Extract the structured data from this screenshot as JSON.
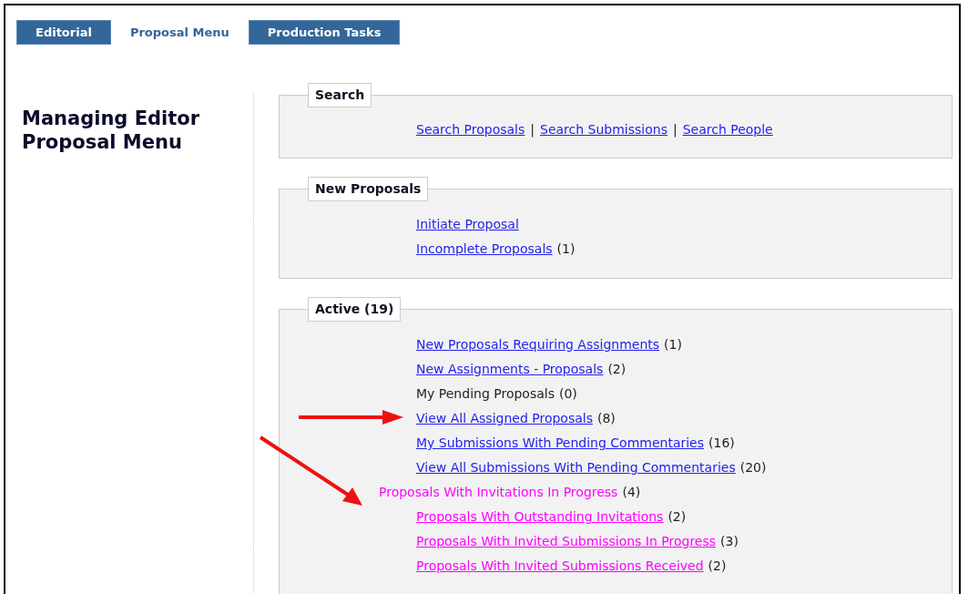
{
  "tabs": [
    {
      "label": "Editorial",
      "selected": false
    },
    {
      "label": "Proposal Menu",
      "selected": true
    },
    {
      "label": "Production Tasks",
      "selected": false
    }
  ],
  "page_title": "Managing Editor Proposal Menu",
  "sections": [
    {
      "title": "Search",
      "kind": "inline",
      "items": [
        {
          "kind": "link",
          "label": "Search Proposals",
          "color": "#2222ee"
        },
        {
          "kind": "separator",
          "label": "|",
          "color": "#222222"
        },
        {
          "kind": "link",
          "label": "Search Submissions",
          "color": "#2222ee"
        },
        {
          "kind": "separator",
          "label": "|",
          "color": "#222222"
        },
        {
          "kind": "link",
          "label": "Search People",
          "color": "#2222ee"
        }
      ]
    },
    {
      "title": "New Proposals",
      "kind": "list",
      "items": [
        {
          "kind": "link",
          "label": "Initiate Proposal",
          "color": "#2222ee"
        },
        {
          "kind": "link",
          "label": "Incomplete Proposals",
          "count": "(1)",
          "color": "#2222ee"
        }
      ]
    },
    {
      "title": "Active (19)",
      "kind": "list",
      "items": [
        {
          "kind": "link",
          "label": "New Proposals Requiring Assignments",
          "count": "(1)",
          "color": "#2222ee"
        },
        {
          "kind": "link",
          "label": "New Assignments - Proposals",
          "count": "(2)",
          "color": "#2222ee"
        },
        {
          "kind": "text",
          "label": "My Pending Proposals",
          "count": "(0)",
          "color": "#222222"
        },
        {
          "kind": "link",
          "label": "View All Assigned Proposals",
          "count": "(8)",
          "color": "#2222ee"
        },
        {
          "kind": "link",
          "label": "My Submissions With Pending Commentaries",
          "count": "(16)",
          "color": "#2222ee"
        },
        {
          "kind": "link",
          "label": "View All Submissions With Pending Commentaries",
          "count": "(20)",
          "color": "#2222ee"
        },
        {
          "kind": "group",
          "label": "Proposals With Invitations In Progress",
          "count": "(4)",
          "color": "#ff00ff",
          "children": [
            {
              "kind": "link",
              "label": "Proposals With Outstanding Invitations",
              "count": "(2)",
              "color": "#ff00ff"
            },
            {
              "kind": "link",
              "label": "Proposals With Invited Submissions In Progress",
              "count": "(3)",
              "color": "#ff00ff"
            },
            {
              "kind": "link",
              "label": "Proposals With Invited Submissions Received",
              "count": "(2)",
              "color": "#ff00ff"
            }
          ]
        }
      ]
    }
  ]
}
